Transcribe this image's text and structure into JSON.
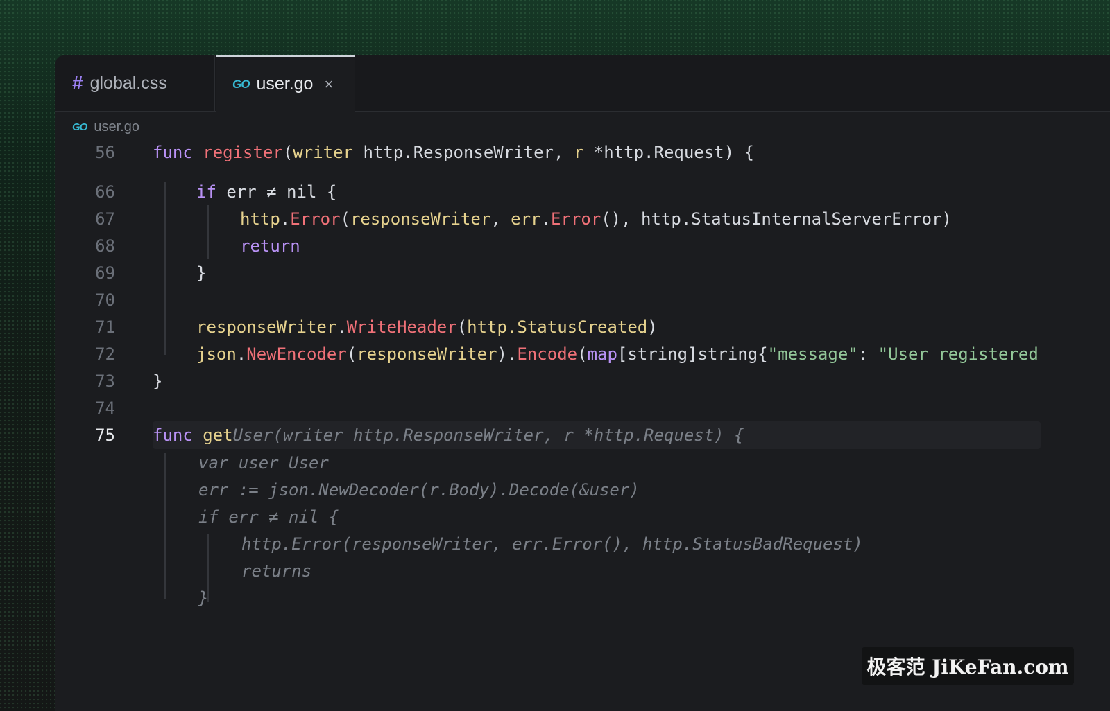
{
  "tabs": [
    {
      "label": "global.css",
      "icon": "css-hash-icon",
      "glyph": "#"
    },
    {
      "label": "user.go",
      "icon": "go-icon",
      "glyph": "GO",
      "close": "×"
    }
  ],
  "breadcrumb": {
    "icon": "GO",
    "label": "user.go"
  },
  "lines": [
    {
      "n": "56",
      "t": [
        {
          "c": "kw",
          "s": "func"
        },
        {
          "s": " "
        },
        {
          "c": "fn",
          "s": "register"
        },
        {
          "s": "("
        },
        {
          "c": "pr",
          "s": "writer"
        },
        {
          "s": " http.ResponseWriter, "
        },
        {
          "c": "pr",
          "s": "r"
        },
        {
          "s": " *http.Request) {"
        }
      ]
    },
    {
      "n": "66",
      "t": [
        {
          "c": "kw",
          "s": "if"
        },
        {
          "s": " err ≠ nil {"
        }
      ]
    },
    {
      "n": "67",
      "t": [
        {
          "c": "pr",
          "s": "http"
        },
        {
          "s": "."
        },
        {
          "c": "fn",
          "s": "Error"
        },
        {
          "s": "("
        },
        {
          "c": "pr",
          "s": "responseWriter"
        },
        {
          "s": ", "
        },
        {
          "c": "pr",
          "s": "err"
        },
        {
          "s": "."
        },
        {
          "c": "fn",
          "s": "Error"
        },
        {
          "s": "(), http.StatusInternalServerError)"
        }
      ]
    },
    {
      "n": "68",
      "t": [
        {
          "c": "kw",
          "s": "return"
        }
      ]
    },
    {
      "n": "69",
      "t": [
        {
          "s": "}"
        }
      ]
    },
    {
      "n": "70",
      "t": []
    },
    {
      "n": "71",
      "t": [
        {
          "c": "pr",
          "s": "responseWriter"
        },
        {
          "s": "."
        },
        {
          "c": "fn",
          "s": "WriteHeader"
        },
        {
          "s": "("
        },
        {
          "c": "pr",
          "s": "http.StatusCreated"
        },
        {
          "s": ")"
        }
      ]
    },
    {
      "n": "72",
      "t": [
        {
          "c": "pr",
          "s": "json"
        },
        {
          "s": "."
        },
        {
          "c": "fn",
          "s": "NewEncoder"
        },
        {
          "s": "("
        },
        {
          "c": "pr",
          "s": "responseWriter"
        },
        {
          "s": ")."
        },
        {
          "c": "fn",
          "s": "Encode"
        },
        {
          "s": "("
        },
        {
          "c": "kw",
          "s": "map"
        },
        {
          "s": "[string]string{"
        },
        {
          "c": "st",
          "s": "\"message\""
        },
        {
          "s": ": "
        },
        {
          "c": "st",
          "s": "\"User registered"
        }
      ]
    },
    {
      "n": "73",
      "t": [
        {
          "s": "}"
        }
      ]
    },
    {
      "n": "74",
      "t": []
    },
    {
      "n": "75",
      "active": true,
      "t": [
        {
          "c": "kw",
          "s": "func"
        },
        {
          "s": " "
        },
        {
          "c": "pr",
          "s": "get"
        },
        {
          "c": "ghost",
          "s": "User(writer http.ResponseWriter, r *http.Request) {"
        }
      ]
    },
    {
      "n": "",
      "t": [
        {
          "c": "ghost",
          "s": "var user User"
        }
      ]
    },
    {
      "n": "",
      "t": [
        {
          "c": "ghost",
          "s": "err := json.NewDecoder(r.Body).Decode(&user)"
        }
      ]
    },
    {
      "n": "",
      "t": [
        {
          "c": "ghost",
          "s": "if err ≠ nil {"
        }
      ]
    },
    {
      "n": "",
      "t": [
        {
          "c": "ghost",
          "s": "http.Error(responseWriter, err.Error(), http.StatusBadRequest)"
        }
      ]
    },
    {
      "n": "",
      "t": [
        {
          "c": "ghost",
          "s": "returns"
        }
      ]
    },
    {
      "n": "",
      "t": [
        {
          "c": "ghost",
          "s": "}"
        }
      ]
    }
  ],
  "watermark": "极客范 JiKeFan.com"
}
